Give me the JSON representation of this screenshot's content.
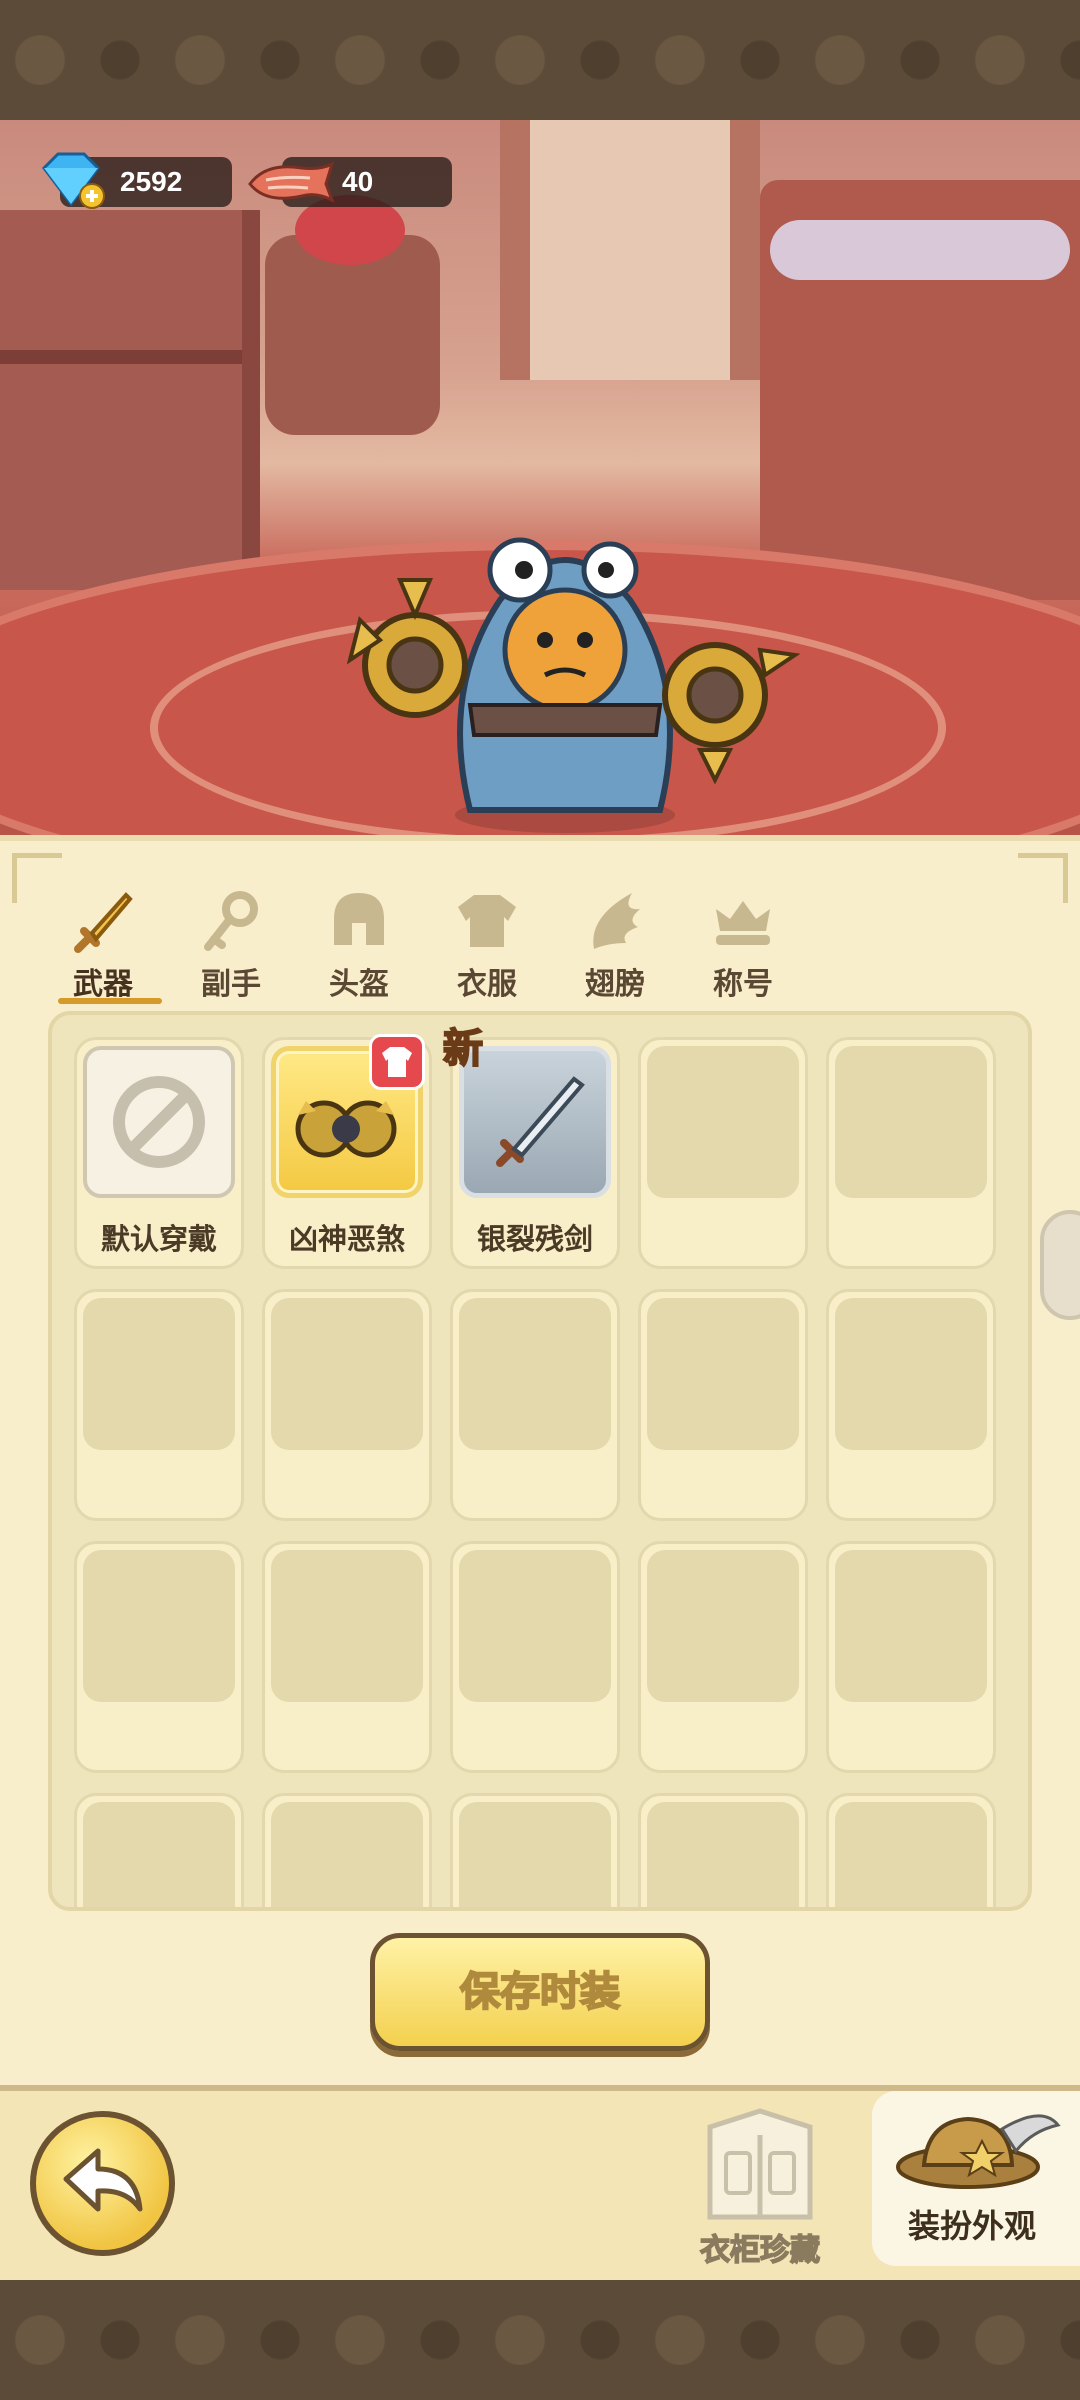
{
  "currency": {
    "gems": "2592",
    "fish": "40"
  },
  "tabs": [
    {
      "label": "武器",
      "icon": "sword-icon",
      "active": true
    },
    {
      "label": "副手",
      "icon": "key-icon",
      "active": false
    },
    {
      "label": "头盔",
      "icon": "helmet-icon",
      "active": false
    },
    {
      "label": "衣服",
      "icon": "armor-icon",
      "active": false
    },
    {
      "label": "翅膀",
      "icon": "wing-icon",
      "active": false
    },
    {
      "label": "称号",
      "icon": "crown-icon",
      "active": false
    }
  ],
  "items": [
    {
      "label": "默认穿戴",
      "state": "default"
    },
    {
      "label": "凶神恶煞",
      "state": "equipped"
    },
    {
      "label": "银裂残剑",
      "state": "new",
      "badge": "新"
    }
  ],
  "save_button": "保存时装",
  "bottom": {
    "wardrobe": "衣柜珍藏",
    "outfit": "装扮外观"
  },
  "colors": {
    "accent_gold": "#f3d04e",
    "panel_bg": "#f8eecb",
    "tab_underline": "#d59a2a"
  }
}
